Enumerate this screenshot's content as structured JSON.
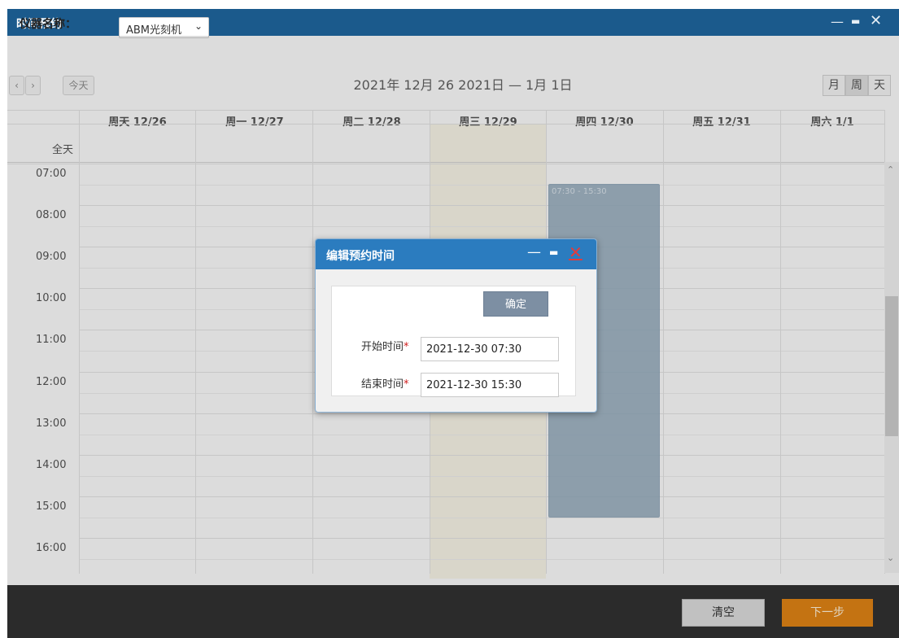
{
  "window": {
    "title": "时间预约",
    "controls": {
      "minimize": "—",
      "maximize": "▬",
      "close": "✕"
    }
  },
  "toolbar": {
    "instrument_label": "仪器名称：",
    "instrument_value": "ABM光刻机",
    "chevron": "⌄",
    "prev": "‹",
    "next": "›",
    "today": "今天",
    "date_range": "2021年 12月 26 2021日 — 1月 1日",
    "views": [
      "月",
      "周",
      "天"
    ]
  },
  "calendar": {
    "columns": [
      "周天 12/26",
      "周一 12/27",
      "周二 12/28",
      "周三 12/29",
      "周四 12/30",
      "周五 12/31",
      "周六 1/1"
    ],
    "all_day_label": "全天",
    "times": [
      "07:00",
      "08:00",
      "09:00",
      "10:00",
      "11:00",
      "12:00",
      "13:00",
      "14:00",
      "15:00",
      "16:00"
    ],
    "event_time": "07:30 - 15:30"
  },
  "dialog": {
    "title": "编辑预约时间",
    "controls": {
      "minimize": "—",
      "maximize": "▬",
      "close": "✕"
    },
    "ok_label": "确定",
    "start_label": "开始时间",
    "end_label": "结束时间",
    "required_mark": "*",
    "start_value": "2021-12-30 07:30",
    "end_value": "2021-12-30 15:30"
  },
  "footer": {
    "clear_label": "清空",
    "next_label": "下一步"
  },
  "colors": {
    "title_bar": "#1b5a8c",
    "dialog_title": "#2b7cbf",
    "next_button": "#d57d14",
    "event": "#7f9bb1",
    "today_col": "#fbf7e6"
  }
}
